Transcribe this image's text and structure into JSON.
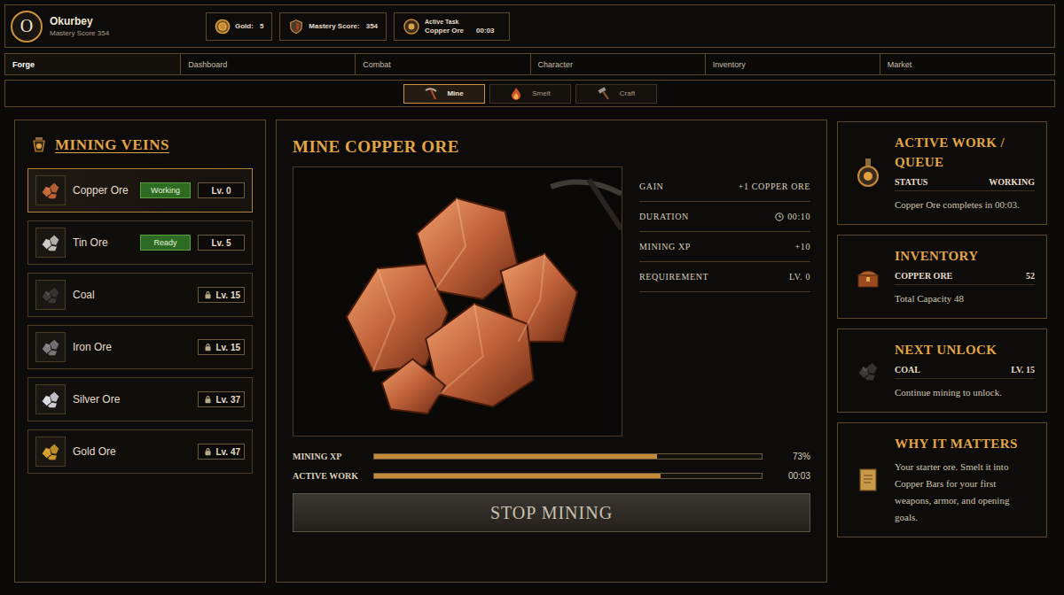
{
  "player": {
    "initial": "O",
    "name": "Okurbey",
    "subtitle": "Mastery Score 354"
  },
  "stats": [
    {
      "kind": "gold",
      "label": "Gold:",
      "value": "5"
    },
    {
      "kind": "mastery",
      "label": "Mastery Score:",
      "value": "354"
    }
  ],
  "active_task": {
    "label": "Active Task",
    "item": "Copper Ore",
    "time": "00:03"
  },
  "nav_tabs": [
    {
      "label": "Forge",
      "selected": true
    },
    {
      "label": "Dashboard",
      "selected": false
    },
    {
      "label": "Combat",
      "selected": false
    },
    {
      "label": "Character",
      "selected": false
    },
    {
      "label": "Inventory",
      "selected": false
    },
    {
      "label": "Market",
      "selected": false
    }
  ],
  "sub_tabs": [
    {
      "kind": "mine",
      "label": "Mine",
      "selected": true
    },
    {
      "kind": "smelt",
      "label": "Smelt",
      "selected": false
    },
    {
      "kind": "craft",
      "label": "Craft",
      "selected": false
    }
  ],
  "veins_panel": {
    "title": "MINING VEINS",
    "veins": [
      {
        "name": "Copper Ore",
        "status": "Working",
        "level": "Lv. 0",
        "locked": false,
        "selected": true,
        "color": "#c8693a"
      },
      {
        "name": "Tin Ore",
        "status": "Ready",
        "level": "Lv. 5",
        "locked": false,
        "selected": false,
        "color": "#c9c9c9"
      },
      {
        "name": "Coal",
        "status": null,
        "level": "Lv. 15",
        "locked": true,
        "selected": false,
        "color": "#3a3a3a"
      },
      {
        "name": "Iron Ore",
        "status": null,
        "level": "Lv. 15",
        "locked": true,
        "selected": false,
        "color": "#7d7d80"
      },
      {
        "name": "Silver Ore",
        "status": null,
        "level": "Lv. 37",
        "locked": true,
        "selected": false,
        "color": "#dcdce4"
      },
      {
        "name": "Gold Ore",
        "status": null,
        "level": "Lv. 47",
        "locked": true,
        "selected": false,
        "color": "#d9a02e"
      }
    ]
  },
  "detail": {
    "title": "MINE COPPER ORE",
    "stats": [
      {
        "kind": "plain",
        "label": "GAIN",
        "value": "+1 COPPER ORE"
      },
      {
        "kind": "timer",
        "label": "DURATION",
        "value": "00:10"
      },
      {
        "kind": "plain",
        "label": "MINING XP",
        "value": "+10"
      },
      {
        "kind": "plain",
        "label": "REQUIREMENT",
        "value": "LV. 0"
      }
    ],
    "bars": [
      {
        "label": "MINING XP",
        "reading": "73%",
        "level": 0.73
      },
      {
        "label": "ACTIVE WORK",
        "reading": "00:03",
        "level": 0.74
      }
    ],
    "button": "STOP MINING"
  },
  "side_cards": [
    {
      "kind": "queue",
      "title": "ACTIVE WORK / QUEUE",
      "rows": [
        {
          "label": "STATUS",
          "value": "WORKING"
        }
      ],
      "note": "Copper Ore completes in 00:03."
    },
    {
      "kind": "inventory",
      "title": "INVENTORY",
      "rows": [
        {
          "label": "COPPER ORE",
          "value": "52"
        }
      ],
      "note": "Total Capacity 48"
    },
    {
      "kind": "unlock",
      "title": "NEXT UNLOCK",
      "rows": [
        {
          "label": "COAL",
          "value": "LV. 15"
        }
      ],
      "note": "Continue mining to unlock."
    },
    {
      "kind": "info",
      "title": "WHY IT MATTERS",
      "rows": [],
      "note": "Your starter ore. Smelt it into Copper Bars for your first weapons, armor, and opening goals."
    }
  ]
}
